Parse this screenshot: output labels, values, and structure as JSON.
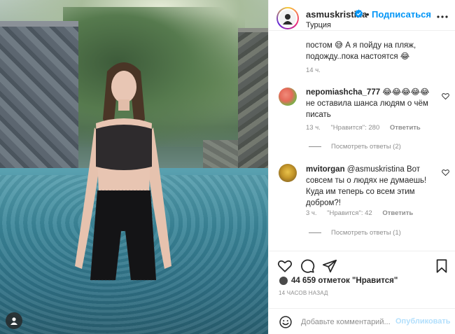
{
  "post": {
    "photo_alt": "",
    "header": {
      "username": "asmuskristina",
      "separator": "•",
      "follow_label": "Подписаться",
      "location": "Турция"
    },
    "comments": [
      {
        "text": "постом 😅 А я пойду на пляж, подожду..пока настоятся 😂",
        "meta_time": "14 ч."
      },
      {
        "username": "nepomiashcha_777",
        "text": " 😂😂😂😂😂 не оставила шанса людям о чём писать",
        "meta_time": "13 ч.",
        "meta_likes": "\"Нравится\": 280",
        "reply_label": "Ответить",
        "view_replies": "Посмотреть ответы (2)"
      },
      {
        "username": "mvitorgan",
        "text": " @asmuskristina Вот совсем ты о людях не думаешь! Куда им теперь со всем этим добром?!",
        "meta_time": "3 ч.",
        "meta_likes": "\"Нравится\": 42",
        "reply_label": "Ответить",
        "view_replies": "Посмотреть ответы (1)"
      }
    ],
    "likes_text": "44 659 отметок \"Нравится\"",
    "time_ago": "14 ЧАСОВ НАЗАД",
    "comment_box": {
      "placeholder": "Добавьте комментарий...",
      "post_label": "Опубликовать"
    }
  },
  "icons": {
    "heart": "heart-icon",
    "comment": "comment-icon",
    "share": "share-icon",
    "save": "bookmark-icon",
    "emoji": "emoji-icon",
    "more": "more-icon",
    "verified": "verified-icon",
    "user_tag": "user-tag-icon"
  },
  "colors": {
    "accent": "#0095f6",
    "muted": "#8e8e8e",
    "post_disabled": "#b2dffc"
  }
}
